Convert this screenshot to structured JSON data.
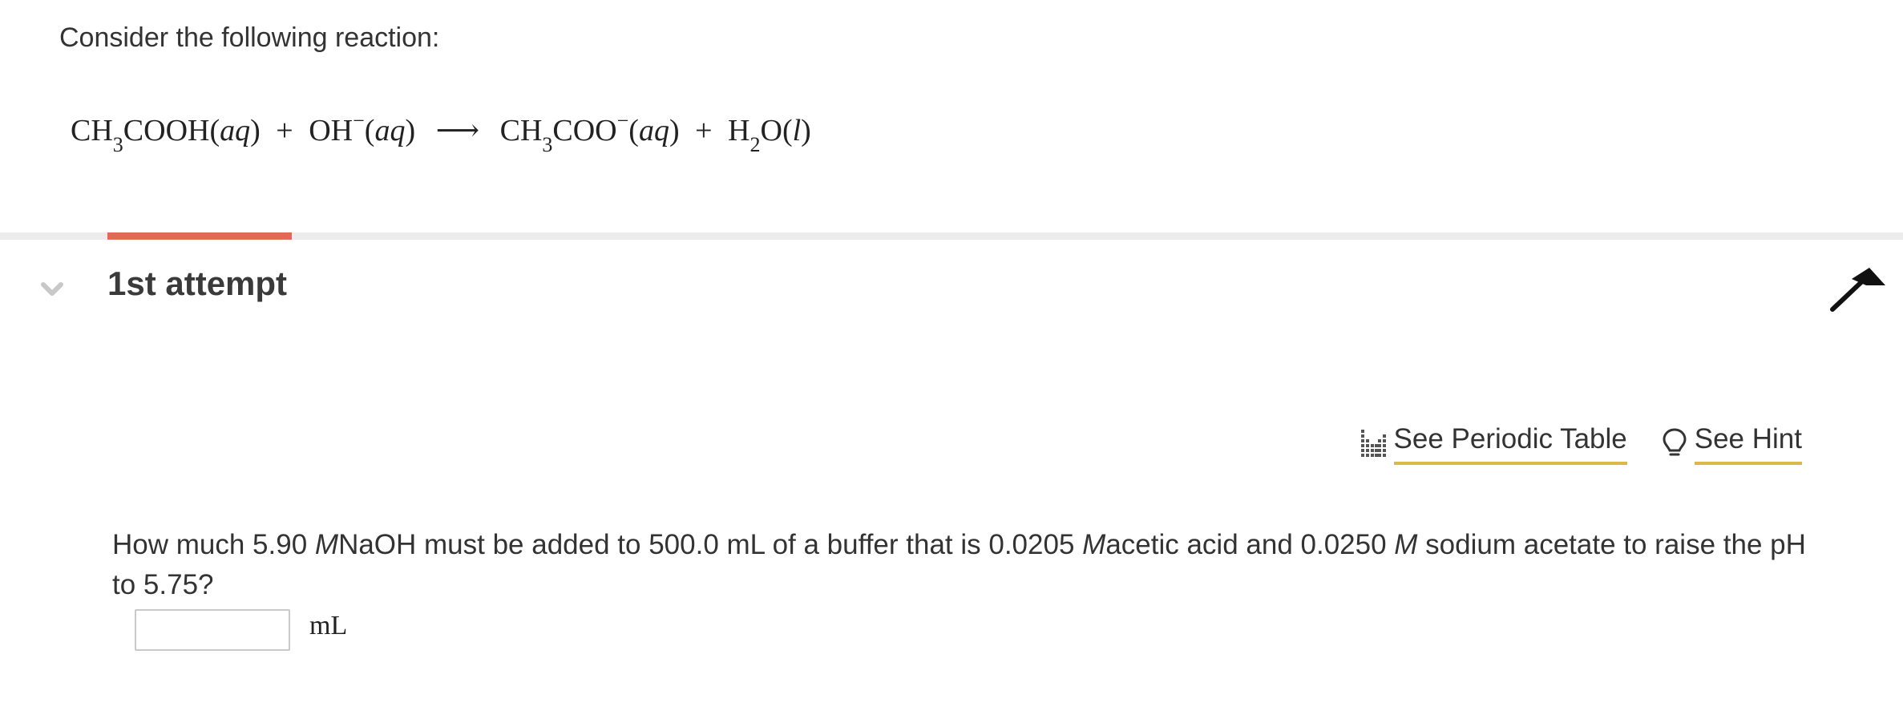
{
  "prompt": {
    "intro": "Consider the following reaction:"
  },
  "equation": {
    "r1_pre": "CH",
    "r1_sub": "3",
    "r1_post": "COOH",
    "r1_state_open": "(",
    "r1_state": "aq",
    "r1_state_close": ")",
    "plus1": "+",
    "r2": "OH",
    "r2_sup": "−",
    "r2_state_open": "(",
    "r2_state": "aq",
    "r2_state_close": ")",
    "arrow": "⟶",
    "p1_pre": "CH",
    "p1_sub": "3",
    "p1_post": "COO",
    "p1_sup": "−",
    "p1_state_open": "(",
    "p1_state": "aq",
    "p1_state_close": ")",
    "plus2": "+",
    "p2_pre": "H",
    "p2_sub": "2",
    "p2_post": "O",
    "p2_state_open": "(",
    "p2_state": "l",
    "p2_state_close": ")"
  },
  "attempt": {
    "title": "1st attempt"
  },
  "tools": {
    "periodic_table": "See Periodic Table",
    "hint": "See Hint"
  },
  "question": {
    "t1": "How much 5.90 ",
    "m1": "M",
    "t2": "NaOH must be added to 500.0 mL of a buffer that is 0.0205 ",
    "m2": "M",
    "t3": "acetic acid and 0.0250 ",
    "m3": "M",
    "t4": " sodium acetate to raise the pH to 5.75?"
  },
  "answer": {
    "value": "",
    "placeholder": "",
    "unit": "mL"
  },
  "colors": {
    "accent": "#e06a52",
    "link_underline": "#d9b94a",
    "divider": "#ececec"
  },
  "icons": {
    "collapse": "chevron-down-icon",
    "flag": "flag-icon",
    "periodic_table": "periodic-table-icon",
    "hint": "lightbulb-icon"
  }
}
